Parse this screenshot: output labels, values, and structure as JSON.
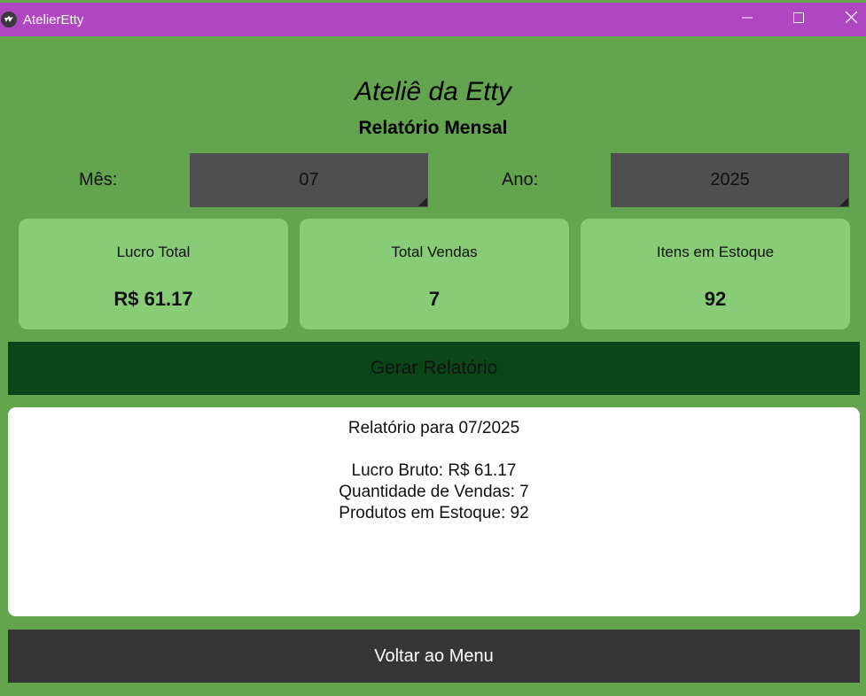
{
  "window": {
    "title": "AtelierEtty"
  },
  "header": {
    "app_name": "Ateliê da Etty",
    "subtitle": "Relatório Mensal"
  },
  "filters": {
    "month_label": "Mês:",
    "month_value": "07",
    "year_label": "Ano:",
    "year_value": "2025"
  },
  "cards": [
    {
      "label": "Lucro Total",
      "value": "R$ 61.17"
    },
    {
      "label": "Total Vendas",
      "value": "7"
    },
    {
      "label": "Itens em Estoque",
      "value": "92"
    }
  ],
  "generate_button_label": "Gerar Relatório",
  "report": {
    "title": "Relatório para 07/2025",
    "lines": [
      "Lucro Bruto: R$ 61.17",
      "Quantidade de Vendas: 7",
      "Produtos em Estoque: 92"
    ]
  },
  "back_button_label": "Voltar ao Menu",
  "colors": {
    "background": "#63a54f",
    "titlebar": "#b146c2",
    "card": "#88cc77",
    "generate_button": "#0b4618",
    "back_button": "#363636",
    "spinner": "#4f4f4f"
  },
  "icons": {
    "app": "kivy-logo-icon",
    "minimize": "minimize-icon",
    "maximize": "maximize-icon",
    "close": "close-icon"
  }
}
